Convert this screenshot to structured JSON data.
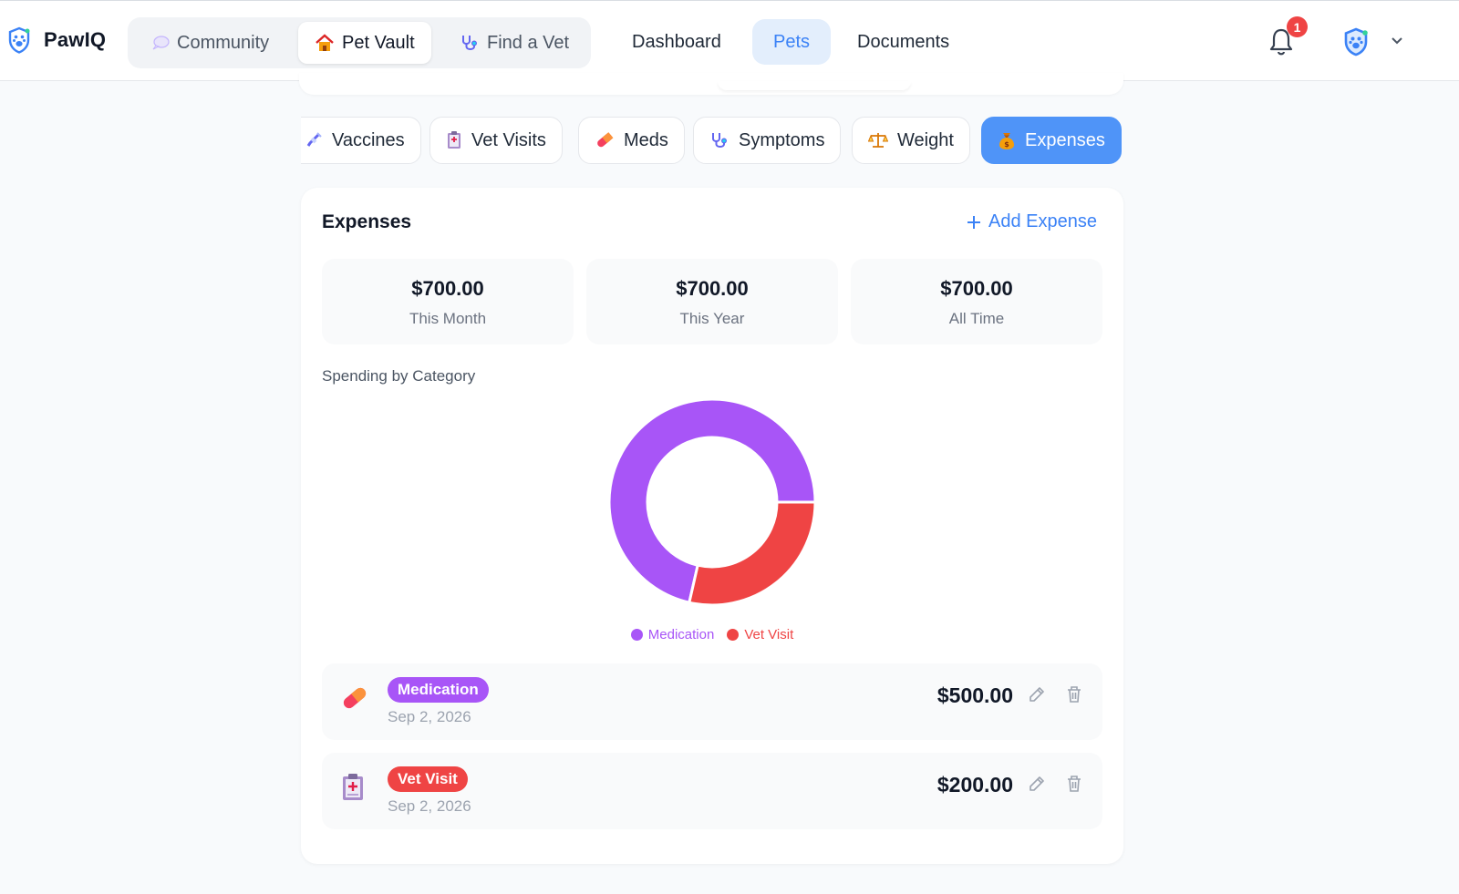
{
  "app": {
    "name": "PawIQ",
    "notification_count": "1"
  },
  "header": {
    "segments": [
      {
        "label": "Community",
        "icon": "speech-bubble-icon"
      },
      {
        "label": "Pet Vault",
        "icon": "house-icon",
        "active": true
      },
      {
        "label": "Find a Vet",
        "icon": "stethoscope-icon"
      }
    ],
    "nav": [
      {
        "label": "Dashboard"
      },
      {
        "label": "Pets",
        "active": true
      },
      {
        "label": "Documents"
      }
    ]
  },
  "tabs": [
    {
      "label": "Vaccines",
      "icon": "syringe-icon"
    },
    {
      "label": "Vet Visits",
      "icon": "clipboard-icon"
    },
    {
      "label": "Meds",
      "icon": "pill-icon"
    },
    {
      "label": "Symptoms",
      "icon": "stethoscope-icon"
    },
    {
      "label": "Weight",
      "icon": "scale-icon"
    },
    {
      "label": "Expenses",
      "icon": "money-bag-icon",
      "active": true
    }
  ],
  "expenses": {
    "title": "Expenses",
    "add_label": "Add Expense",
    "stats": [
      {
        "value": "$700.00",
        "label": "This Month"
      },
      {
        "value": "$700.00",
        "label": "This Year"
      },
      {
        "value": "$700.00",
        "label": "All Time"
      }
    ],
    "chart_title": "Spending by Category",
    "entries": [
      {
        "category": "Medication",
        "date": "Sep 2, 2026",
        "amount": "$500.00",
        "color": "#a855f7",
        "icon": "pill-icon"
      },
      {
        "category": "Vet Visit",
        "date": "Sep 2, 2026",
        "amount": "$200.00",
        "color": "#ef4444",
        "icon": "clipboard-icon"
      }
    ]
  },
  "chart_data": {
    "type": "pie",
    "title": "Spending by Category",
    "categories": [
      "Medication",
      "Vet Visit"
    ],
    "values": [
      500,
      200
    ],
    "colors": [
      "#a855f7",
      "#ef4444"
    ],
    "legend": "bottom"
  },
  "colors": {
    "accent": "#3b82f6",
    "active_tab": "#4f94f8",
    "medication": "#a855f7",
    "vet_visit": "#ef4444"
  }
}
